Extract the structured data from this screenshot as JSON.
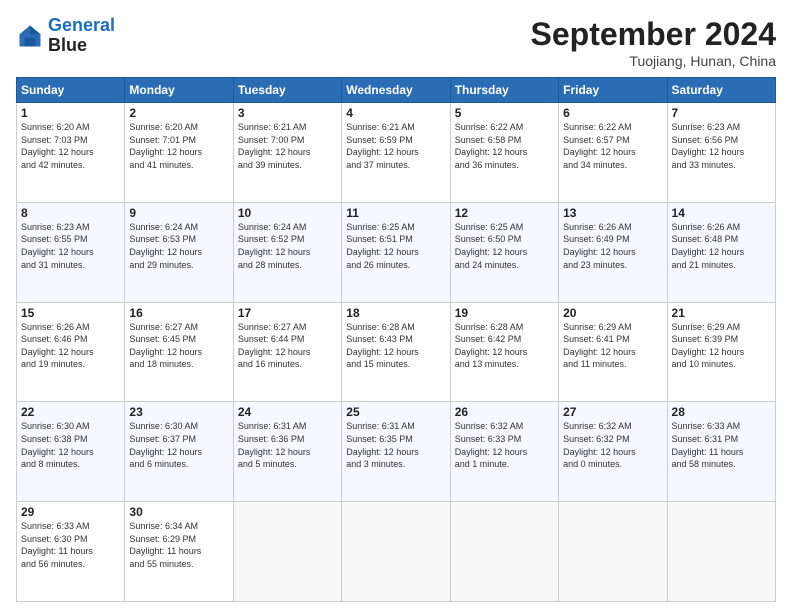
{
  "header": {
    "logo_line1": "General",
    "logo_line2": "Blue",
    "month_title": "September 2024",
    "location": "Tuojiang, Hunan, China"
  },
  "weekdays": [
    "Sunday",
    "Monday",
    "Tuesday",
    "Wednesday",
    "Thursday",
    "Friday",
    "Saturday"
  ],
  "weeks": [
    [
      {
        "day": "1",
        "lines": [
          "Sunrise: 6:20 AM",
          "Sunset: 7:03 PM",
          "Daylight: 12 hours",
          "and 42 minutes."
        ]
      },
      {
        "day": "2",
        "lines": [
          "Sunrise: 6:20 AM",
          "Sunset: 7:01 PM",
          "Daylight: 12 hours",
          "and 41 minutes."
        ]
      },
      {
        "day": "3",
        "lines": [
          "Sunrise: 6:21 AM",
          "Sunset: 7:00 PM",
          "Daylight: 12 hours",
          "and 39 minutes."
        ]
      },
      {
        "day": "4",
        "lines": [
          "Sunrise: 6:21 AM",
          "Sunset: 6:59 PM",
          "Daylight: 12 hours",
          "and 37 minutes."
        ]
      },
      {
        "day": "5",
        "lines": [
          "Sunrise: 6:22 AM",
          "Sunset: 6:58 PM",
          "Daylight: 12 hours",
          "and 36 minutes."
        ]
      },
      {
        "day": "6",
        "lines": [
          "Sunrise: 6:22 AM",
          "Sunset: 6:57 PM",
          "Daylight: 12 hours",
          "and 34 minutes."
        ]
      },
      {
        "day": "7",
        "lines": [
          "Sunrise: 6:23 AM",
          "Sunset: 6:56 PM",
          "Daylight: 12 hours",
          "and 33 minutes."
        ]
      }
    ],
    [
      {
        "day": "8",
        "lines": [
          "Sunrise: 6:23 AM",
          "Sunset: 6:55 PM",
          "Daylight: 12 hours",
          "and 31 minutes."
        ]
      },
      {
        "day": "9",
        "lines": [
          "Sunrise: 6:24 AM",
          "Sunset: 6:53 PM",
          "Daylight: 12 hours",
          "and 29 minutes."
        ]
      },
      {
        "day": "10",
        "lines": [
          "Sunrise: 6:24 AM",
          "Sunset: 6:52 PM",
          "Daylight: 12 hours",
          "and 28 minutes."
        ]
      },
      {
        "day": "11",
        "lines": [
          "Sunrise: 6:25 AM",
          "Sunset: 6:51 PM",
          "Daylight: 12 hours",
          "and 26 minutes."
        ]
      },
      {
        "day": "12",
        "lines": [
          "Sunrise: 6:25 AM",
          "Sunset: 6:50 PM",
          "Daylight: 12 hours",
          "and 24 minutes."
        ]
      },
      {
        "day": "13",
        "lines": [
          "Sunrise: 6:26 AM",
          "Sunset: 6:49 PM",
          "Daylight: 12 hours",
          "and 23 minutes."
        ]
      },
      {
        "day": "14",
        "lines": [
          "Sunrise: 6:26 AM",
          "Sunset: 6:48 PM",
          "Daylight: 12 hours",
          "and 21 minutes."
        ]
      }
    ],
    [
      {
        "day": "15",
        "lines": [
          "Sunrise: 6:26 AM",
          "Sunset: 6:46 PM",
          "Daylight: 12 hours",
          "and 19 minutes."
        ]
      },
      {
        "day": "16",
        "lines": [
          "Sunrise: 6:27 AM",
          "Sunset: 6:45 PM",
          "Daylight: 12 hours",
          "and 18 minutes."
        ]
      },
      {
        "day": "17",
        "lines": [
          "Sunrise: 6:27 AM",
          "Sunset: 6:44 PM",
          "Daylight: 12 hours",
          "and 16 minutes."
        ]
      },
      {
        "day": "18",
        "lines": [
          "Sunrise: 6:28 AM",
          "Sunset: 6:43 PM",
          "Daylight: 12 hours",
          "and 15 minutes."
        ]
      },
      {
        "day": "19",
        "lines": [
          "Sunrise: 6:28 AM",
          "Sunset: 6:42 PM",
          "Daylight: 12 hours",
          "and 13 minutes."
        ]
      },
      {
        "day": "20",
        "lines": [
          "Sunrise: 6:29 AM",
          "Sunset: 6:41 PM",
          "Daylight: 12 hours",
          "and 11 minutes."
        ]
      },
      {
        "day": "21",
        "lines": [
          "Sunrise: 6:29 AM",
          "Sunset: 6:39 PM",
          "Daylight: 12 hours",
          "and 10 minutes."
        ]
      }
    ],
    [
      {
        "day": "22",
        "lines": [
          "Sunrise: 6:30 AM",
          "Sunset: 6:38 PM",
          "Daylight: 12 hours",
          "and 8 minutes."
        ]
      },
      {
        "day": "23",
        "lines": [
          "Sunrise: 6:30 AM",
          "Sunset: 6:37 PM",
          "Daylight: 12 hours",
          "and 6 minutes."
        ]
      },
      {
        "day": "24",
        "lines": [
          "Sunrise: 6:31 AM",
          "Sunset: 6:36 PM",
          "Daylight: 12 hours",
          "and 5 minutes."
        ]
      },
      {
        "day": "25",
        "lines": [
          "Sunrise: 6:31 AM",
          "Sunset: 6:35 PM",
          "Daylight: 12 hours",
          "and 3 minutes."
        ]
      },
      {
        "day": "26",
        "lines": [
          "Sunrise: 6:32 AM",
          "Sunset: 6:33 PM",
          "Daylight: 12 hours",
          "and 1 minute."
        ]
      },
      {
        "day": "27",
        "lines": [
          "Sunrise: 6:32 AM",
          "Sunset: 6:32 PM",
          "Daylight: 12 hours",
          "and 0 minutes."
        ]
      },
      {
        "day": "28",
        "lines": [
          "Sunrise: 6:33 AM",
          "Sunset: 6:31 PM",
          "Daylight: 11 hours",
          "and 58 minutes."
        ]
      }
    ],
    [
      {
        "day": "29",
        "lines": [
          "Sunrise: 6:33 AM",
          "Sunset: 6:30 PM",
          "Daylight: 11 hours",
          "and 56 minutes."
        ]
      },
      {
        "day": "30",
        "lines": [
          "Sunrise: 6:34 AM",
          "Sunset: 6:29 PM",
          "Daylight: 11 hours",
          "and 55 minutes."
        ]
      },
      null,
      null,
      null,
      null,
      null
    ]
  ]
}
